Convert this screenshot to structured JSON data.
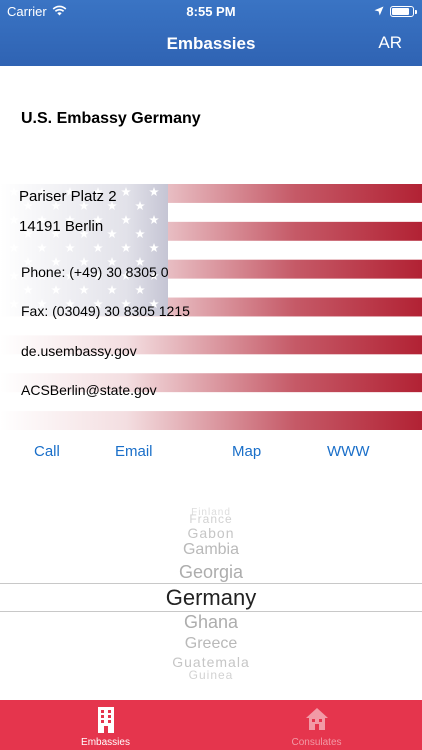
{
  "status_bar": {
    "carrier": "Carrier",
    "time": "8:55 PM",
    "battery_level": 0.85
  },
  "nav": {
    "title": "Embassies",
    "right_button": "AR"
  },
  "embassy": {
    "name": "U.S. Embassy Germany",
    "address_line1": "Pariser Platz 2",
    "address_line2": "14191 Berlin",
    "phone": "Phone: (+49) 30 8305 0",
    "fax": "Fax: (03049) 30 8305 1215",
    "website": "de.usembassy.gov",
    "email": "ACSBerlin@state.gov"
  },
  "actions": {
    "call": "Call",
    "email": "Email",
    "map": "Map",
    "www": "WWW"
  },
  "picker": {
    "items": [
      "Finland",
      "France",
      "Gabon",
      "Gambia",
      "Georgia",
      "Germany",
      "Ghana",
      "Greece",
      "Guatemala",
      "Guinea"
    ],
    "selected": "Germany"
  },
  "tabbar": {
    "tabs": [
      {
        "label": "Embassies",
        "icon": "building-icon",
        "active": true
      },
      {
        "label": "Consulates",
        "icon": "house-icon",
        "active": false
      }
    ],
    "color_active": "#ffffff",
    "color_inactive": "#f29aa6",
    "background": "#e5354d"
  },
  "colors": {
    "nav_background": "#2f63b3",
    "link": "#1a6fc9",
    "flag_red": "#b22234",
    "flag_blue": "#3c3b6e"
  }
}
